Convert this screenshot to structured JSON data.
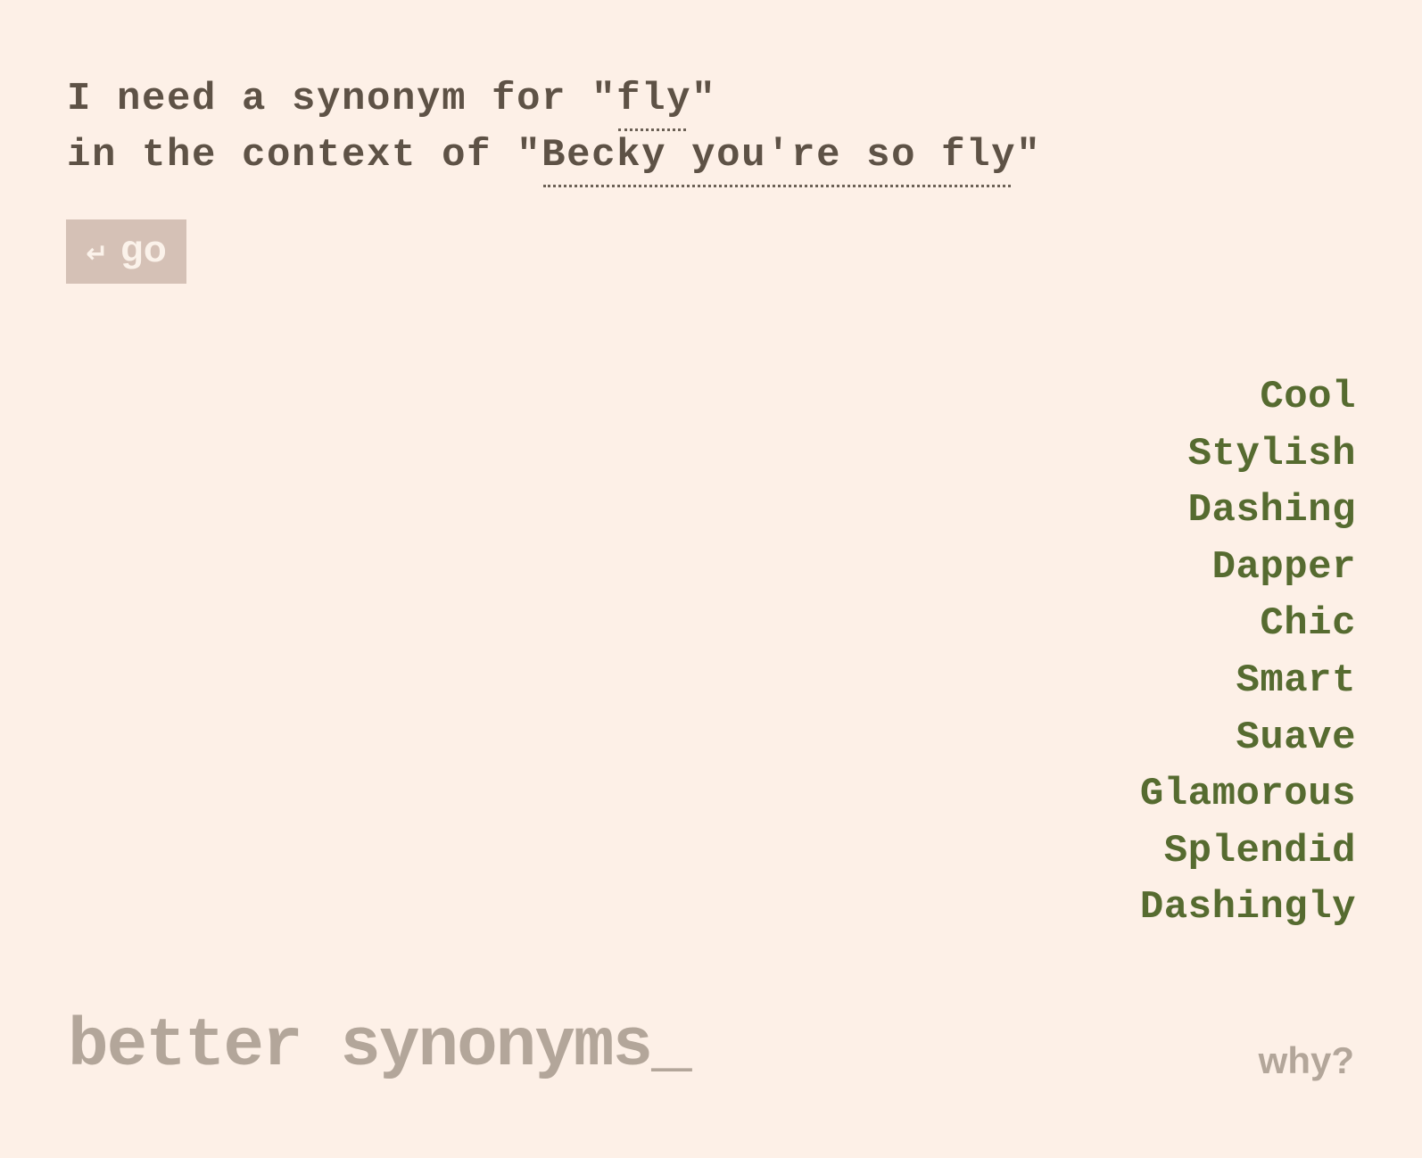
{
  "query": {
    "prefix": "I need a synonym for \"",
    "word": "fly",
    "suffix_line1": "\"",
    "context_prefix": "in the context of \"",
    "context": "Becky you're so fly",
    "context_suffix": "\""
  },
  "go_button": {
    "icon": "↵",
    "icon_name": "enter-icon",
    "label": "go"
  },
  "results": [
    "Cool",
    "Stylish",
    "Dashing",
    "Dapper",
    "Chic",
    "Smart",
    "Suave",
    "Glamorous",
    "Splendid",
    "Dashingly"
  ],
  "footer": {
    "brand": "better synonyms_",
    "why_link": "why?"
  },
  "colors": {
    "background": "#fdf0e7",
    "text": "#5e5246",
    "result": "#566b30",
    "muted": "#b3a69a",
    "button_bg": "#d5c1b6"
  }
}
